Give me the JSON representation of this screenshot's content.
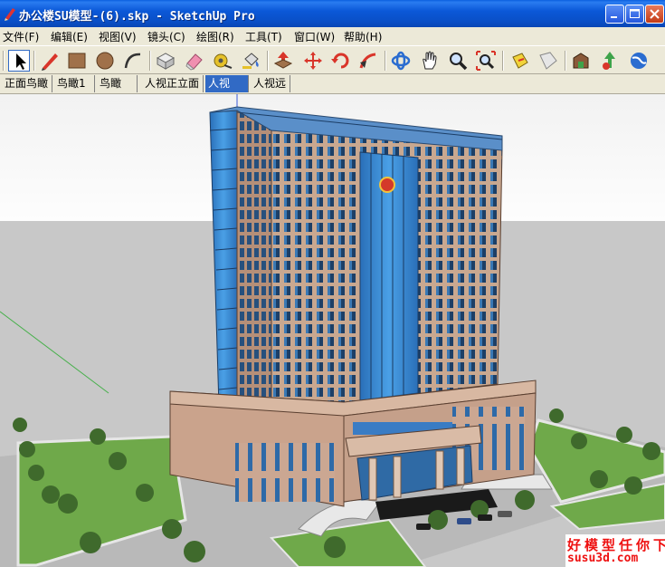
{
  "window": {
    "title": "办公楼SU模型-(6).skp - SketchUp Pro"
  },
  "menu": [
    {
      "label": "文件(F)"
    },
    {
      "label": "编辑(E)"
    },
    {
      "label": "视图(V)"
    },
    {
      "label": "镜头(C)"
    },
    {
      "label": "绘图(R)"
    },
    {
      "label": "工具(T)"
    },
    {
      "label": "窗口(W)"
    },
    {
      "label": "帮助(H)"
    }
  ],
  "toolbar": [
    "select-tool-icon",
    "pencil-line-tool-icon",
    "rectangle-tool-icon",
    "circle-tool-icon",
    "arc-tool-icon",
    "make-component-icon",
    "eraser-tool-icon",
    "tape-measure-icon",
    "paint-bucket-icon",
    "push-pull-icon",
    "move-tool-icon",
    "rotate-tool-icon",
    "follow-me-icon",
    "orbit-tool-icon",
    "pan-tool-icon",
    "zoom-tool-icon",
    "zoom-extents-icon",
    "section-plane-icon",
    "section-fill-icon",
    "component-warehouse-icon",
    "add-location-icon",
    "google-earth-icon"
  ],
  "scenes": [
    {
      "label": "正面鸟瞰",
      "active": false
    },
    {
      "label": "鸟瞰1",
      "active": false
    },
    {
      "label": "鸟瞰",
      "active": false
    },
    {
      "label": "人视正立面",
      "active": false
    },
    {
      "label": "人视",
      "active": true
    },
    {
      "label": "人视远",
      "active": false
    }
  ],
  "watermark": {
    "line1": "好模型任你下",
    "line2": "susu3d.com"
  },
  "colors": {
    "title_bar": "#0b58d8",
    "sky": "#f7f7f7",
    "ground": "#c8c8c8",
    "lawn": "#6fa94a",
    "facade_stone": "#c7a48c",
    "curtain_glass": "#3c8fd6",
    "active_tab": "#316ac5"
  }
}
